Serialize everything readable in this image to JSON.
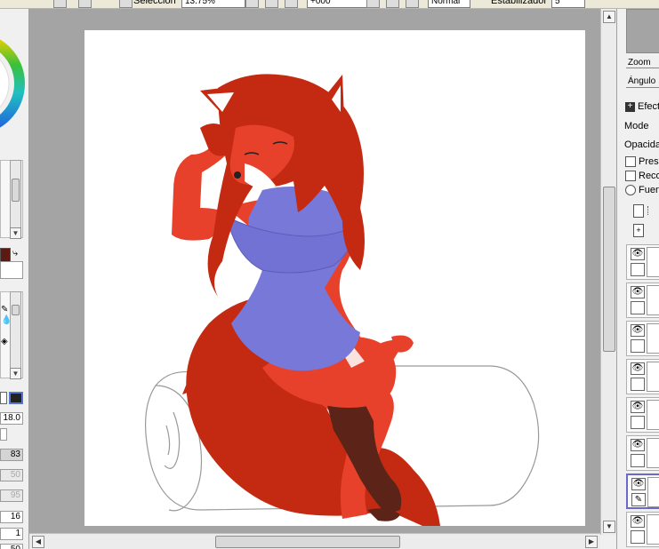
{
  "toolbar": {
    "selection_label": "Selección",
    "zoom_value": "13.75%",
    "angle_value": "+000",
    "blend_mode": "Normal",
    "stabilizer_label": "Estabilizador",
    "stabilizer_value": "5"
  },
  "left_panel": {
    "brush_size": "18.0",
    "values": [
      "83",
      "50",
      "95",
      "16",
      "1",
      "50"
    ]
  },
  "right_panel": {
    "navigator": {
      "zoom_label": "Zoom",
      "angle_label": "Ángulo"
    },
    "layer_props": {
      "effects_label": "Efectos",
      "mode_label": "Mode",
      "opacity_label": "Opacidad",
      "preserve_label": "Preservar opacidad",
      "clip_label": "Recortar grupo",
      "source_label": "Fuente de selección"
    },
    "layers": [
      {
        "eye": "👁",
        "lock": "",
        "selected": false
      },
      {
        "eye": "👁",
        "lock": "",
        "selected": false
      },
      {
        "eye": "👁",
        "lock": "",
        "selected": false
      },
      {
        "eye": "👁",
        "lock": "",
        "selected": false
      },
      {
        "eye": "👁",
        "lock": "",
        "selected": false
      },
      {
        "eye": "👁",
        "lock": "",
        "selected": false
      },
      {
        "eye": "👁",
        "lock": "✎",
        "selected": true
      },
      {
        "eye": "👁",
        "lock": "",
        "selected": false
      }
    ]
  },
  "colors": {
    "fur_red": "#e8412b",
    "hair_red": "#c42a12",
    "dress_blue": "#7878d8",
    "boot_brown": "#5c2418",
    "canvas_bg": "#a4a4a4",
    "selected_layer": "#6a6acd"
  }
}
